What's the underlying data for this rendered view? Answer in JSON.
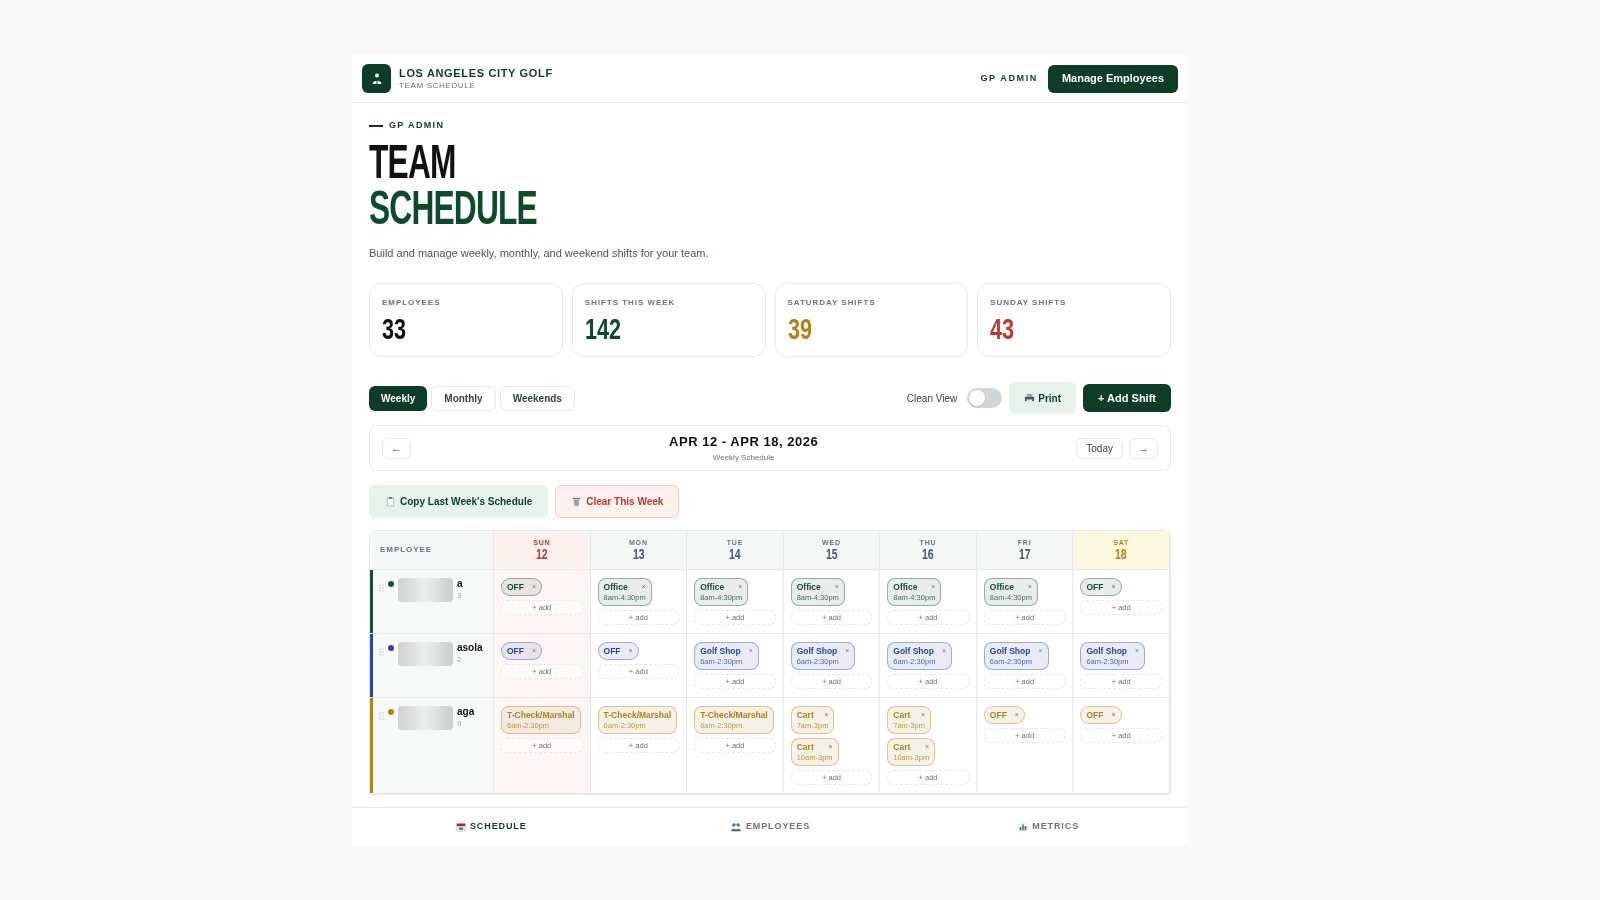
{
  "brand": {
    "name": "LOS ANGELES CITY GOLF",
    "subtitle": "TEAM SCHEDULE"
  },
  "header": {
    "user": "GP ADMIN",
    "button": "Manage Employees"
  },
  "eyebrow": "GP ADMIN",
  "title": [
    "TEAM",
    "SCHEDULE"
  ],
  "description": "Build and manage weekly, monthly, and weekend shifts for your team.",
  "stats": [
    {
      "label": "EMPLOYEES",
      "value": "33",
      "color": "#111111"
    },
    {
      "label": "SHIFTS THIS WEEK",
      "value": "142",
      "color": "#0d4a2c"
    },
    {
      "label": "SATURDAY SHIFTS",
      "value": "39",
      "color": "#b3801a"
    },
    {
      "label": "SUNDAY SHIFTS",
      "value": "43",
      "color": "#c0392b"
    }
  ],
  "view_tabs": [
    {
      "label": "Weekly",
      "selected": true
    },
    {
      "label": "Monthly",
      "selected": false
    },
    {
      "label": "Weekends",
      "selected": false
    }
  ],
  "clean_view": {
    "label": "Clean View",
    "on": false
  },
  "print": "Print",
  "add_shift": "+ Add Shift",
  "date_nav": {
    "prev": "←",
    "range": "APR 12 - APR 18, 2026",
    "subtitle": "Weekly Schedule",
    "today": "Today",
    "next": "→"
  },
  "actions": [
    {
      "kind": "copy",
      "label": "Copy Last Week's Schedule"
    },
    {
      "kind": "clear",
      "label": "Clear This Week"
    }
  ],
  "schedule": {
    "employee_header": "EMPLOYEE",
    "days": [
      {
        "weekday": "SUN",
        "date": "12",
        "kind": "sunday"
      },
      {
        "weekday": "MON",
        "date": "13",
        "kind": "weekday"
      },
      {
        "weekday": "TUE",
        "date": "14",
        "kind": "weekday"
      },
      {
        "weekday": "WED",
        "date": "15",
        "kind": "weekday"
      },
      {
        "weekday": "THU",
        "date": "16",
        "kind": "weekday"
      },
      {
        "weekday": "FRI",
        "date": "17",
        "kind": "weekday"
      },
      {
        "weekday": "SAT",
        "date": "18",
        "kind": "saturday"
      }
    ],
    "rows": [
      {
        "name": "a",
        "detail": "3",
        "color": "#1a4d33",
        "cells": [
          {
            "shifts": [
              {
                "role": "OFF",
                "remove": "×"
              }
            ],
            "add": "+ add"
          },
          {
            "shifts": [
              {
                "role": "Office",
                "time": "8am-4:30pm",
                "remove": "×"
              }
            ],
            "add": "+ add"
          },
          {
            "shifts": [
              {
                "role": "Office",
                "time": "8am-4:30pm",
                "remove": "×"
              }
            ],
            "add": "+ add"
          },
          {
            "shifts": [
              {
                "role": "Office",
                "time": "8am-4:30pm",
                "remove": "×"
              }
            ],
            "add": "+ add"
          },
          {
            "shifts": [
              {
                "role": "Office",
                "time": "8am-4:30pm",
                "remove": "×"
              }
            ],
            "add": "+ add"
          },
          {
            "shifts": [
              {
                "role": "Office",
                "time": "8am-4:30pm",
                "remove": "×"
              }
            ],
            "add": "+ add"
          },
          {
            "shifts": [
              {
                "role": "OFF",
                "remove": "×"
              }
            ],
            "add": "+ add"
          }
        ]
      },
      {
        "name": "asola",
        "detail": "2",
        "color": "#2b45a6",
        "cells": [
          {
            "shifts": [
              {
                "role": "OFF",
                "remove": "×"
              }
            ],
            "add": "+ add"
          },
          {
            "shifts": [
              {
                "role": "OFF",
                "remove": "×"
              }
            ],
            "add": "+ add"
          },
          {
            "shifts": [
              {
                "role": "Golf Shop",
                "time": "6am-2:30pm",
                "remove": "×"
              }
            ],
            "add": "+ add"
          },
          {
            "shifts": [
              {
                "role": "Golf Shop",
                "time": "6am-2:30pm",
                "remove": "×"
              }
            ],
            "add": "+ add"
          },
          {
            "shifts": [
              {
                "role": "Golf Shop",
                "time": "6am-2:30pm",
                "remove": "×"
              }
            ],
            "add": "+ add"
          },
          {
            "shifts": [
              {
                "role": "Golf Shop",
                "time": "6am-2:30pm",
                "remove": "×"
              }
            ],
            "add": "+ add"
          },
          {
            "shifts": [
              {
                "role": "Golf Shop",
                "time": "6am-2:30pm",
                "remove": "×"
              }
            ],
            "add": "+ add"
          }
        ]
      },
      {
        "name": "aga",
        "detail": "9",
        "color": "#b3801a",
        "cells": [
          {
            "shifts": [
              {
                "role": "T-Check/Marshal",
                "time": "6am-2:30pm"
              }
            ],
            "add": "+ add"
          },
          {
            "shifts": [
              {
                "role": "T-Check/Marshal",
                "time": "6am-2:30pm"
              }
            ],
            "add": "+ add"
          },
          {
            "shifts": [
              {
                "role": "T-Check/Marshal",
                "time": "6am-2:30pm"
              }
            ],
            "add": "+ add"
          },
          {
            "shifts": [
              {
                "role": "Cart",
                "time": "7am-3pm",
                "remove": "×"
              },
              {
                "role": "Cart",
                "time": "10am-3pm",
                "remove": "×"
              }
            ],
            "add": "+ add"
          },
          {
            "shifts": [
              {
                "role": "Cart",
                "time": "7am-3pm",
                "remove": "×"
              },
              {
                "role": "Cart",
                "time": "10am-3pm",
                "remove": "×"
              }
            ],
            "add": "+ add"
          },
          {
            "shifts": [
              {
                "role": "OFF",
                "remove": "×"
              }
            ],
            "add": "+ add"
          },
          {
            "shifts": [
              {
                "role": "OFF",
                "remove": "×"
              }
            ],
            "add": "+ add"
          }
        ]
      }
    ]
  },
  "bottom_nav": [
    {
      "kind": "schedule",
      "label": "SCHEDULE",
      "selected": true
    },
    {
      "kind": "employees",
      "label": "EMPLOYEES",
      "selected": false
    },
    {
      "kind": "metrics",
      "label": "METRICS",
      "selected": false
    }
  ]
}
